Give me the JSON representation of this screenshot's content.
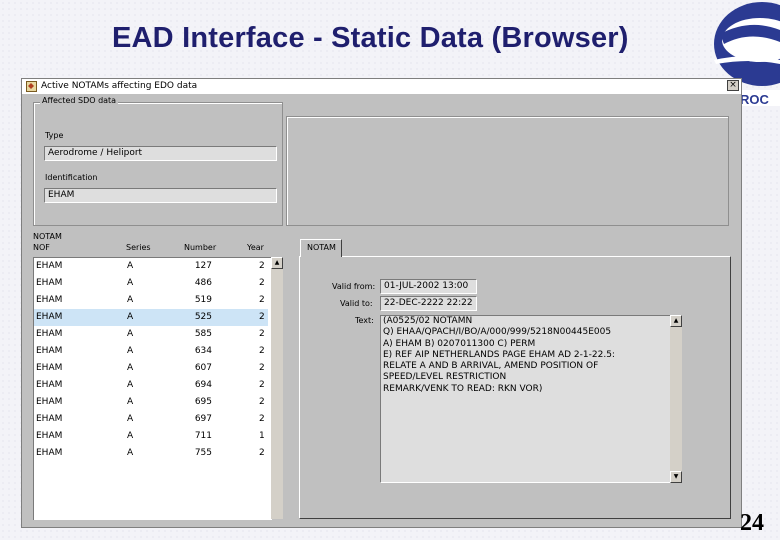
{
  "slide": {
    "title": "EAD Interface - Static Data (Browser)",
    "page_number": "24",
    "logo_text": "ROC"
  },
  "window": {
    "title": "Active NOTAMs affecting EDO data",
    "close_label": "×"
  },
  "affected": {
    "group_label": "Affected SDO data",
    "type_label": "Type",
    "type_value": "Aerodrome / Heliport",
    "ident_label": "Identification",
    "ident_value": "EHAM"
  },
  "notam_list": {
    "section_label": "NOTAM",
    "columns": [
      "NOF",
      "Series",
      "Number",
      "Year"
    ],
    "rows": [
      {
        "nof": "EHAM",
        "series": "A",
        "number": "127",
        "year": "2"
      },
      {
        "nof": "EHAM",
        "series": "A",
        "number": "486",
        "year": "2"
      },
      {
        "nof": "EHAM",
        "series": "A",
        "number": "519",
        "year": "2"
      },
      {
        "nof": "EHAM",
        "series": "A",
        "number": "525",
        "year": "2"
      },
      {
        "nof": "EHAM",
        "series": "A",
        "number": "585",
        "year": "2"
      },
      {
        "nof": "EHAM",
        "series": "A",
        "number": "634",
        "year": "2"
      },
      {
        "nof": "EHAM",
        "series": "A",
        "number": "607",
        "year": "2"
      },
      {
        "nof": "EHAM",
        "series": "A",
        "number": "694",
        "year": "2"
      },
      {
        "nof": "EHAM",
        "series": "A",
        "number": "695",
        "year": "2"
      },
      {
        "nof": "EHAM",
        "series": "A",
        "number": "697",
        "year": "2"
      },
      {
        "nof": "EHAM",
        "series": "A",
        "number": "711",
        "year": "1"
      },
      {
        "nof": "EHAM",
        "series": "A",
        "number": "755",
        "year": "2"
      }
    ],
    "selected_index": 3
  },
  "detail": {
    "tab_label": "NOTAM",
    "valid_from_label": "Valid from:",
    "valid_from_value": "01-JUL-2002 13:00",
    "valid_to_label": "Valid to:",
    "valid_to_value": "22-DEC-2222 22:22",
    "text_label": "Text:",
    "text_lines": [
      "(A0525/02 NOTAMN",
      "Q) EHAA/QPACH/I/BO/A/000/999/5218N00445E005",
      "A) EHAM B) 0207011300 C) PERM",
      "E) REF AIP NETHERLANDS PAGE EHAM AD 2-1-22.5:",
      "RELATE A AND B ARRIVAL, AMEND POSITION OF",
      "SPEED/LEVEL RESTRICTION",
      "REMARK/VENK TO READ: RKN VOR)"
    ]
  }
}
